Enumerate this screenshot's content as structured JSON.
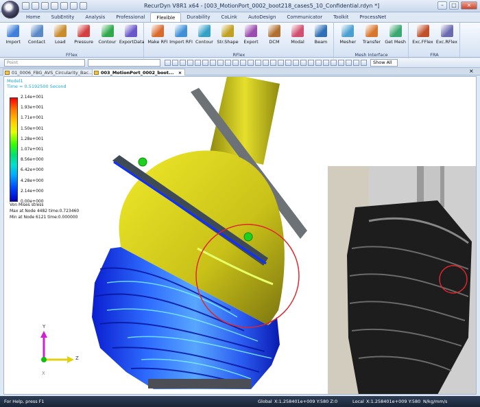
{
  "window": {
    "title": "RecurDyn V8R1 x64 - [003_MotionPort_0002_boot218_cases5_10_Confidential.rdyn *]"
  },
  "ribbon_tabs": [
    "Home",
    "SubEntity",
    "Analysis",
    "Professional",
    "Flexible",
    "Durability",
    "CoLink",
    "AutoDesign",
    "Communicator",
    "Toolkit",
    "ProcessNet"
  ],
  "active_tab": "Flexible",
  "ribbon_groups": [
    {
      "label": "FFlex",
      "buttons": [
        "Import",
        "Contact",
        "Load",
        "Pressure",
        "Contour",
        "ExportData"
      ]
    },
    {
      "label": "RFlex",
      "buttons": [
        "Make RFI",
        "Import RFI",
        "Contour",
        "Str.Shape",
        "Export",
        "DCM",
        "Modal",
        "Beam"
      ]
    },
    {
      "label": "Mesh Interface",
      "buttons": [
        "Mesher",
        "Transfer",
        "Get Mesh"
      ]
    },
    {
      "label": "FRA",
      "buttons": [
        "Exc.FFlex",
        "Exc.RFlex"
      ]
    }
  ],
  "toolbar": {
    "entity_select_placeholder": "Point",
    "show_select": "Show All"
  },
  "doc_tabs": [
    {
      "label": "01_0006_FBG_AVS_Circularity_Bac..."
    },
    {
      "label": "003_MotionPort_0002_boot..."
    }
  ],
  "viewport": {
    "model_name": "Model1",
    "time_label": "Time = 0.5192500 Second",
    "legend": {
      "values": [
        "2.14e+001",
        "1.93e+001",
        "1.71e+001",
        "1.50e+001",
        "1.28e+001",
        "1.07e+001",
        "8.56e+000",
        "6.42e+000",
        "4.28e+000",
        "2.14e+000",
        "0.00e+000"
      ],
      "result_name": "Von Mises stress",
      "max_text": "Max at Node 4482 time:0.723460",
      "min_text": "Min at Node 6121 time:0.000000"
    },
    "triad": {
      "x": "X",
      "y": "Y",
      "z": "Z"
    }
  },
  "statusbar": {
    "help": "For Help, press F1",
    "global": "Global",
    "global_coords": "X:1.258401e+009 Y:580 Z:0",
    "local": "Local",
    "local_coords": "X:1.258401e+009 Y:580",
    "units": "N/kg/mm/s"
  },
  "colors": {
    "highlight_circle": "#e0262b",
    "yellow_part": "#c8c21a",
    "legend_text_cyan": "#1aa7d8"
  }
}
